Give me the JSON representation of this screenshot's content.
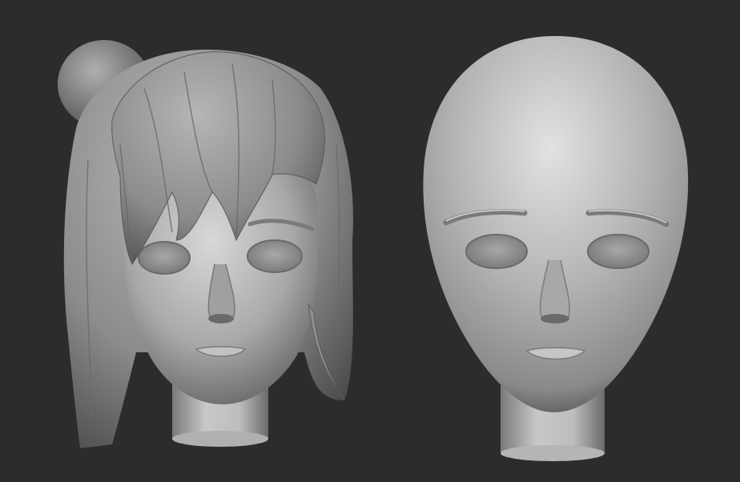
{
  "scene": {
    "background_color": "#2c2c2c",
    "material_color": "#9a9a9a",
    "models": [
      {
        "name": "head-with-hair",
        "icon": "sculpt-head-hair-icon"
      },
      {
        "name": "bald-head",
        "icon": "sculpt-head-bald-icon"
      }
    ]
  }
}
